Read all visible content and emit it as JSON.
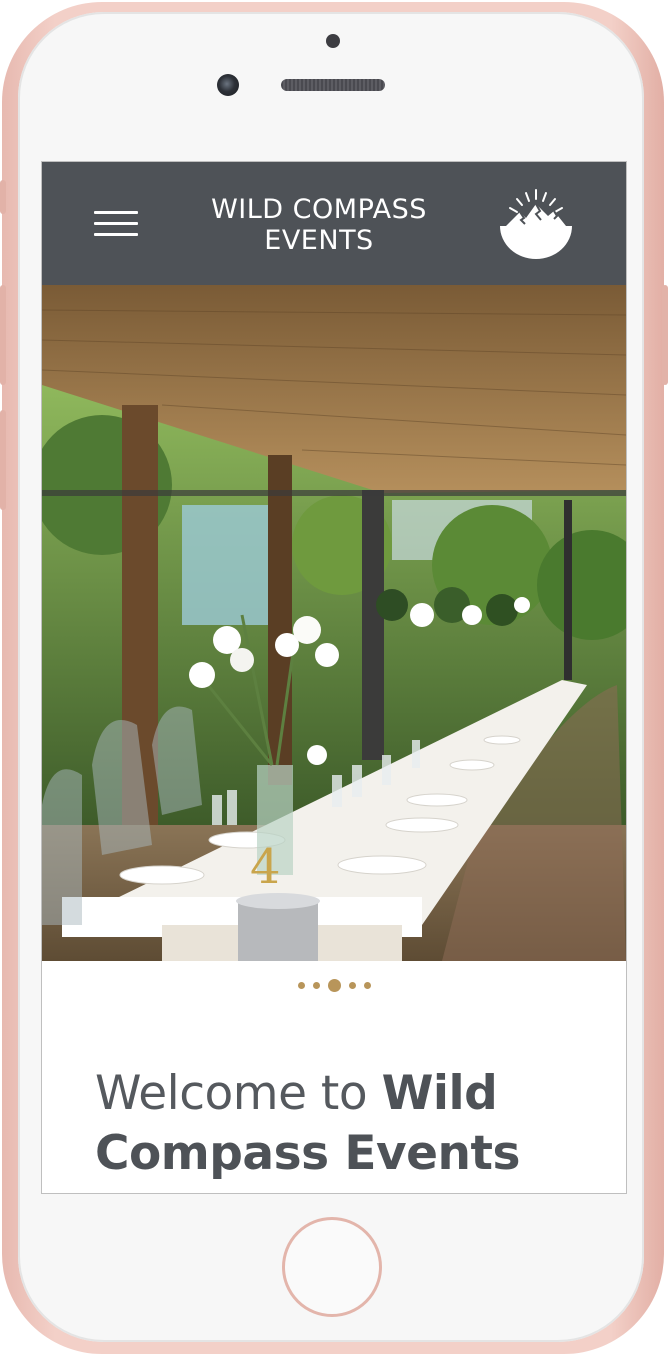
{
  "header": {
    "title_line1": "WILD COMPASS",
    "title_line2": "EVENTS",
    "menu_icon": "hamburger-icon",
    "logo_icon": "mountain-sun-logo"
  },
  "hero": {
    "image": "event-venue-long-table-photo",
    "table_number": "4"
  },
  "carousel": {
    "slide_count": 5,
    "active_index": 2,
    "dot_color": "#b8955a"
  },
  "welcome": {
    "prefix": "Welcome to ",
    "bold_line1": "Wild",
    "bold_line2": "Compass Events"
  },
  "colors": {
    "header_bg": "#4e5257",
    "accent_gold": "#b8955a",
    "phone_rose": "#f3d0c8"
  }
}
